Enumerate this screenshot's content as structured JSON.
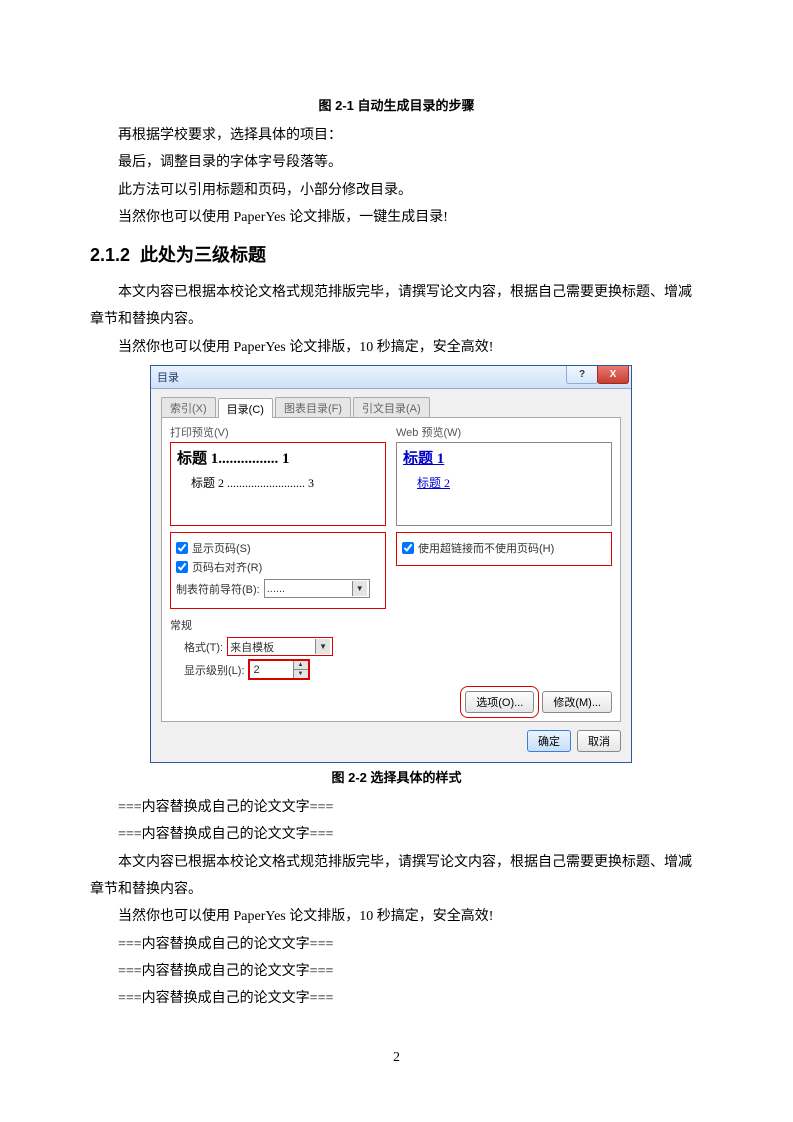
{
  "caption1": "图 2-1  自动生成目录的步骤",
  "para1": "再根据学校要求，选择具体的项目：",
  "para2": "最后，调整目录的字体字号段落等。",
  "para3": "此方法可以引用标题和页码，小部分修改目录。",
  "para4": "当然你也可以使用 PaperYes 论文排版，一键生成目录!",
  "h3_num": "2.1.2",
  "h3_title": "此处为三级标题",
  "para5": "本文内容已根据本校论文格式规范排版完毕，请撰写论文内容，根据自己需要更换标题、增减章节和替换内容。",
  "para6": "当然你也可以使用 PaperYes 论文排版，10 秒搞定，安全高效!",
  "dialog": {
    "title": "目录",
    "help_btn": "?",
    "close_btn": "X",
    "tabs": {
      "index": "索引(X)",
      "toc": "目录(C)",
      "figtoc": "图表目录(F)",
      "cittoc": "引文目录(A)"
    },
    "print_preview_label": "打印预览(V)",
    "web_preview_label": "Web 预览(W)",
    "preview_line1_left": "标题 1",
    "preview_line1_dots": "................",
    "preview_line1_pg": "1",
    "preview_line2_left": "标题 2",
    "preview_line2_dots": "..........................",
    "preview_line2_pg": "3",
    "web_link1": "标题 1",
    "web_link2": "标题 2",
    "chk_show_pagenum": "显示页码(S)",
    "chk_right_align": "页码右对齐(R)",
    "lbl_tab_leader": "制表符前导符(B):",
    "tab_leader_val": "......",
    "chk_hyperlink": "使用超链接而不使用页码(H)",
    "general_label": "常规",
    "lbl_format": "格式(T):",
    "format_val": "来自模板",
    "lbl_levels": "显示级别(L):",
    "levels_val": "2",
    "btn_options": "选项(O)...",
    "btn_modify": "修改(M)...",
    "btn_ok": "确定",
    "btn_cancel": "取消"
  },
  "caption2": "图 2-2  选择具体的样式",
  "para7": "===内容替换成自己的论文文字===",
  "para8": "===内容替换成自己的论文文字===",
  "para9": "本文内容已根据本校论文格式规范排版完毕，请撰写论文内容，根据自己需要更换标题、增减章节和替换内容。",
  "para10": "当然你也可以使用 PaperYes 论文排版，10 秒搞定，安全高效!",
  "para11": "===内容替换成自己的论文文字===",
  "para12": "===内容替换成自己的论文文字===",
  "para13": "===内容替换成自己的论文文字===",
  "page_number": "2"
}
